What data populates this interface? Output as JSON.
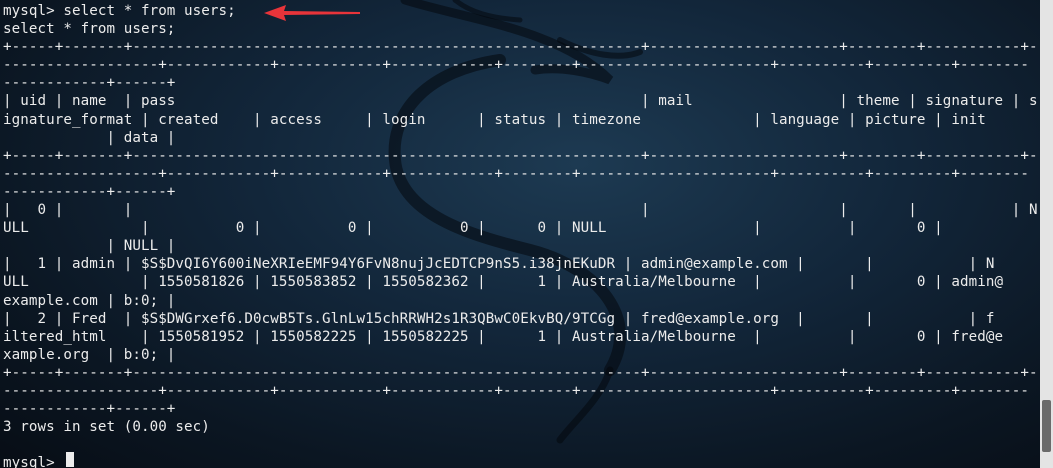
{
  "terminal": {
    "lines": [
      "mysql> select * from users;",
      "select * from users;",
      "+-----+-------+-----------------------------------------------------------+----------------------+--------+-----------+--",
      "------------------+------------+------------+------------+--------+----------------------+----------+---------+--------",
      "------------+------+",
      "| uid | name  | pass                                                      | mail                 | theme | signature | s",
      "ignature_format | created    | access     | login      | status | timezone             | language | picture | init",
      "            | data |",
      "+-----+-------+-----------------------------------------------------------+----------------------+--------+-----------+--",
      "------------------+------------+------------+------------+--------+----------------------+----------+---------+--------",
      "------------+------+",
      "|   0 |       |                                                           |                      |       |           | N",
      "ULL             |          0 |          0 |          0 |      0 | NULL                 |          |       0 |",
      "            | NULL |",
      "|   1 | admin | $S$DvQI6Y600iNeXRIeEMF94Y6FvN8nujJcEDTCP9nS5.i38jnEKuDR | admin@example.com |       |           | N",
      "ULL             | 1550581826 | 1550583852 | 1550582362 |      1 | Australia/Melbourne  |          |       0 | admin@",
      "example.com | b:0; |",
      "|   2 | Fred  | $S$DWGrxef6.D0cwB5Ts.GlnLw15chRRWH2s1R3QBwC0EkvBQ/9TCGg | fred@example.org  |       |           | f",
      "iltered_html    | 1550581952 | 1550582225 | 1550582225 |      1 | Australia/Melbourne  |          |       0 | fred@e",
      "xample.org  | b:0; |",
      "+-----+-------+-----------------------------------------------------------+----------------------+--------+-----------+--",
      "------------------+------------+------------+------------+--------+----------------------+----------+---------+--------",
      "------------+------+",
      "3 rows in set (0.00 sec)",
      "",
      "mysql> "
    ]
  },
  "colors": {
    "background": "#0b1622",
    "text": "#ececec",
    "arrow": "#e8343a",
    "scrollbar_track": "#e4e4e4",
    "scrollbar_thumb": "#6a6a6a"
  },
  "icons": {
    "annotation": "red-arrow-icon",
    "watermark": "kali-dragon-icon"
  }
}
